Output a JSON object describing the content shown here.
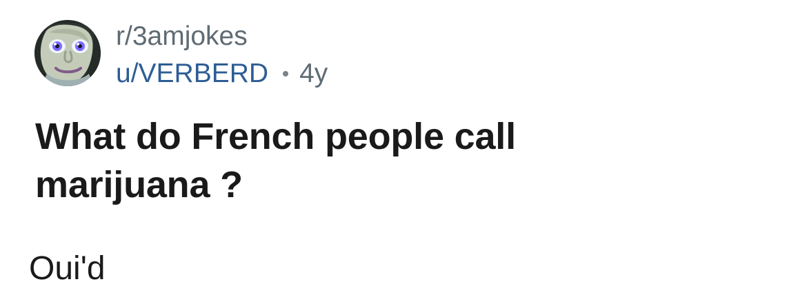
{
  "post": {
    "subreddit": "r/3amjokes",
    "username": "u/VERBERD",
    "separator": "•",
    "age": "4y",
    "title": "What do French people call marijuana ?",
    "body": "Oui'd"
  },
  "icons": {
    "avatar": "user-avatar-icon",
    "separator": "dot-separator-icon"
  },
  "colors": {
    "subreddit_text": "#5f6b73",
    "username_link": "#2d5d95",
    "title_text": "#1a1a1b",
    "body_text": "#1a1a1b",
    "background": "#ffffff"
  }
}
